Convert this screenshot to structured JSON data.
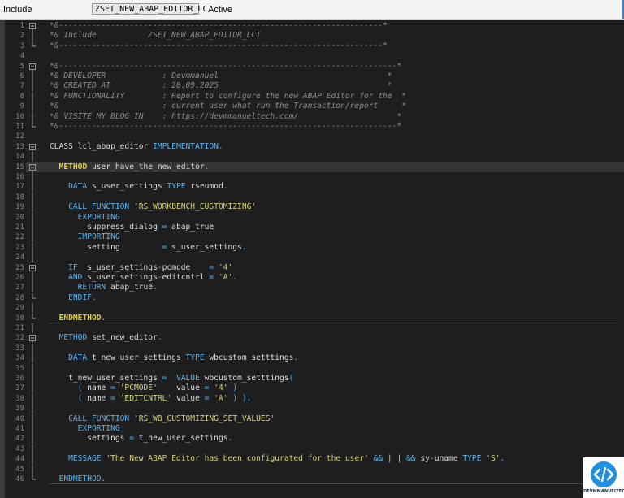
{
  "header": {
    "field_label": "Include",
    "object_name": "ZSET_NEW_ABAP_EDITOR_LCI",
    "status": "Active"
  },
  "editor": {
    "current_line": 15,
    "lines": [
      {
        "n": 1,
        "fold": "open",
        "segs": [
          [
            "c",
            "*&---------------------------------------------------------------------*"
          ]
        ]
      },
      {
        "n": 2,
        "fold": "bar",
        "segs": [
          [
            "c",
            "*& Include           ZSET_NEW_ABAP_EDITOR_LCI"
          ]
        ]
      },
      {
        "n": 3,
        "fold": "end",
        "segs": [
          [
            "c",
            "*&---------------------------------------------------------------------*"
          ]
        ]
      },
      {
        "n": 4,
        "fold": "",
        "segs": []
      },
      {
        "n": 5,
        "fold": "open",
        "segs": [
          [
            "c",
            "*&------------------------------------------------------------------------*"
          ]
        ]
      },
      {
        "n": 6,
        "fold": "bar",
        "segs": [
          [
            "c",
            "*& DEVELOPER            : Devmmanuel                                    *"
          ]
        ]
      },
      {
        "n": 7,
        "fold": "bar",
        "segs": [
          [
            "c",
            "*& CREATED AT           : 20.09.2025                                    *"
          ]
        ]
      },
      {
        "n": 8,
        "fold": "bar",
        "segs": [
          [
            "c",
            "*& FUNCTIONALITY        : Report to configure the new ABAP Editor for the  *"
          ]
        ]
      },
      {
        "n": 9,
        "fold": "bar",
        "segs": [
          [
            "c",
            "*&                      : current user what run the Transaction/report     *"
          ]
        ]
      },
      {
        "n": 10,
        "fold": "bar",
        "segs": [
          [
            "c",
            "*& VISITE MY BLOG IN    : https://devmmanueltech.com/                     *"
          ]
        ]
      },
      {
        "n": 11,
        "fold": "end",
        "segs": [
          [
            "c",
            "*&------------------------------------------------------------------------*"
          ]
        ]
      },
      {
        "n": 12,
        "fold": "",
        "segs": []
      },
      {
        "n": 13,
        "fold": "open",
        "segs": [
          [
            "i",
            "CLASS lcl_abap_editor "
          ],
          [
            "k",
            "IMPLEMENTATION"
          ],
          [
            "o",
            "."
          ]
        ]
      },
      {
        "n": 14,
        "fold": "bar",
        "segs": []
      },
      {
        "n": 15,
        "fold": "open",
        "segs": [
          [
            "i",
            "  "
          ],
          [
            "ky",
            "METHOD"
          ],
          [
            "i",
            " user_have_the_new_editor"
          ],
          [
            "o",
            "."
          ]
        ]
      },
      {
        "n": 16,
        "fold": "bar",
        "segs": []
      },
      {
        "n": 17,
        "fold": "bar",
        "segs": [
          [
            "i",
            "    "
          ],
          [
            "k",
            "DATA"
          ],
          [
            "i",
            " s_user_settings "
          ],
          [
            "k",
            "TYPE"
          ],
          [
            "i",
            " rseumod"
          ],
          [
            "o",
            "."
          ]
        ]
      },
      {
        "n": 18,
        "fold": "bar",
        "segs": []
      },
      {
        "n": 19,
        "fold": "bar",
        "segs": [
          [
            "i",
            "    "
          ],
          [
            "k",
            "CALL FUNCTION"
          ],
          [
            "i",
            " "
          ],
          [
            "s",
            "'RS_WORKBENCH_CUSTOMIZING'"
          ]
        ]
      },
      {
        "n": 20,
        "fold": "bar",
        "segs": [
          [
            "i",
            "      "
          ],
          [
            "k",
            "EXPORTING"
          ]
        ]
      },
      {
        "n": 21,
        "fold": "bar",
        "segs": [
          [
            "i",
            "        suppress_dialog "
          ],
          [
            "o",
            "="
          ],
          [
            "i",
            " abap_true"
          ]
        ]
      },
      {
        "n": 22,
        "fold": "bar",
        "segs": [
          [
            "i",
            "      "
          ],
          [
            "k",
            "IMPORTING"
          ]
        ]
      },
      {
        "n": 23,
        "fold": "bar",
        "segs": [
          [
            "i",
            "        setting         "
          ],
          [
            "o",
            "="
          ],
          [
            "i",
            " s_user_settings"
          ],
          [
            "o",
            "."
          ]
        ]
      },
      {
        "n": 24,
        "fold": "bar",
        "segs": []
      },
      {
        "n": 25,
        "fold": "open",
        "segs": [
          [
            "i",
            "    "
          ],
          [
            "k",
            "IF"
          ],
          [
            "i",
            "  s_user_settings"
          ],
          [
            "o",
            "-"
          ],
          [
            "i",
            "pcmode    "
          ],
          [
            "o",
            "="
          ],
          [
            "i",
            " "
          ],
          [
            "s",
            "'4'"
          ]
        ]
      },
      {
        "n": 26,
        "fold": "bar",
        "segs": [
          [
            "i",
            "    "
          ],
          [
            "k",
            "AND"
          ],
          [
            "i",
            " s_user_settings"
          ],
          [
            "o",
            "-"
          ],
          [
            "i",
            "editcntrl "
          ],
          [
            "o",
            "="
          ],
          [
            "i",
            " "
          ],
          [
            "s",
            "'A'"
          ],
          [
            "o",
            "."
          ]
        ]
      },
      {
        "n": 27,
        "fold": "bar",
        "segs": [
          [
            "i",
            "      "
          ],
          [
            "k",
            "RETURN"
          ],
          [
            "i",
            " abap_true"
          ],
          [
            "o",
            "."
          ]
        ]
      },
      {
        "n": 28,
        "fold": "end",
        "segs": [
          [
            "i",
            "    "
          ],
          [
            "k",
            "ENDIF"
          ],
          [
            "o",
            "."
          ]
        ]
      },
      {
        "n": 29,
        "fold": "bar",
        "segs": []
      },
      {
        "n": 30,
        "fold": "end",
        "segs": [
          [
            "i",
            "  "
          ],
          [
            "ky",
            "ENDMETHOD"
          ],
          [
            "o",
            "."
          ]
        ]
      },
      {
        "n": 31,
        "fold": "bar",
        "segs": []
      },
      {
        "n": 32,
        "fold": "open",
        "segs": [
          [
            "i",
            "  "
          ],
          [
            "k",
            "METHOD"
          ],
          [
            "i",
            " set_new_editor"
          ],
          [
            "o",
            "."
          ]
        ]
      },
      {
        "n": 33,
        "fold": "bar",
        "segs": []
      },
      {
        "n": 34,
        "fold": "bar",
        "segs": [
          [
            "i",
            "    "
          ],
          [
            "k",
            "DATA"
          ],
          [
            "i",
            " t_new_user_settings "
          ],
          [
            "k",
            "TYPE"
          ],
          [
            "i",
            " wbcustom_setttings"
          ],
          [
            "o",
            "."
          ]
        ]
      },
      {
        "n": 35,
        "fold": "bar",
        "segs": []
      },
      {
        "n": 36,
        "fold": "bar",
        "segs": [
          [
            "i",
            "    t_new_user_settings "
          ],
          [
            "o",
            "="
          ],
          [
            "i",
            "  "
          ],
          [
            "k",
            "VALUE"
          ],
          [
            "i",
            " wbcustom_setttings"
          ],
          [
            "o",
            "("
          ]
        ]
      },
      {
        "n": 37,
        "fold": "bar",
        "segs": [
          [
            "i",
            "      "
          ],
          [
            "o",
            "("
          ],
          [
            "i",
            " name "
          ],
          [
            "o",
            "="
          ],
          [
            "i",
            " "
          ],
          [
            "s",
            "'PCMODE'"
          ],
          [
            "i",
            "    value "
          ],
          [
            "o",
            "="
          ],
          [
            "i",
            " "
          ],
          [
            "s",
            "'4'"
          ],
          [
            "i",
            " "
          ],
          [
            "o",
            ")"
          ]
        ]
      },
      {
        "n": 38,
        "fold": "bar",
        "segs": [
          [
            "i",
            "      "
          ],
          [
            "o",
            "("
          ],
          [
            "i",
            " name "
          ],
          [
            "o",
            "="
          ],
          [
            "i",
            " "
          ],
          [
            "s",
            "'EDITCNTRL'"
          ],
          [
            "i",
            " value "
          ],
          [
            "o",
            "="
          ],
          [
            "i",
            " "
          ],
          [
            "s",
            "'A'"
          ],
          [
            "i",
            " "
          ],
          [
            "o",
            ")"
          ],
          [
            "i",
            " "
          ],
          [
            "o",
            ")."
          ]
        ]
      },
      {
        "n": 39,
        "fold": "bar",
        "segs": []
      },
      {
        "n": 40,
        "fold": "bar",
        "segs": [
          [
            "i",
            "    "
          ],
          [
            "k",
            "CALL FUNCTION"
          ],
          [
            "i",
            " "
          ],
          [
            "s",
            "'RS_WB_CUSTOMIZING_SET_VALUES'"
          ]
        ]
      },
      {
        "n": 41,
        "fold": "bar",
        "segs": [
          [
            "i",
            "      "
          ],
          [
            "k",
            "EXPORTING"
          ]
        ]
      },
      {
        "n": 42,
        "fold": "bar",
        "segs": [
          [
            "i",
            "        settings "
          ],
          [
            "o",
            "="
          ],
          [
            "i",
            " t_new_user_settings"
          ],
          [
            "o",
            "."
          ]
        ]
      },
      {
        "n": 43,
        "fold": "bar",
        "segs": []
      },
      {
        "n": 44,
        "fold": "bar",
        "segs": [
          [
            "i",
            "    "
          ],
          [
            "k",
            "MESSAGE"
          ],
          [
            "i",
            " "
          ],
          [
            "s",
            "'The New ABAP Editor has been configurated for the user'"
          ],
          [
            "i",
            " "
          ],
          [
            "o",
            "&&"
          ],
          [
            "i",
            " "
          ],
          [
            "s",
            "|"
          ],
          [
            "i",
            " "
          ],
          [
            "s",
            "|"
          ],
          [
            "i",
            " "
          ],
          [
            "o",
            "&&"
          ],
          [
            "i",
            " sy"
          ],
          [
            "o",
            "-"
          ],
          [
            "i",
            "uname "
          ],
          [
            "k",
            "TYPE"
          ],
          [
            "i",
            " "
          ],
          [
            "s",
            "'S'"
          ],
          [
            "o",
            "."
          ]
        ]
      },
      {
        "n": 45,
        "fold": "bar",
        "segs": []
      },
      {
        "n": 46,
        "fold": "end",
        "segs": [
          [
            "i",
            "  "
          ],
          [
            "k",
            "ENDMETHOD"
          ],
          [
            "o",
            "."
          ]
        ]
      }
    ]
  },
  "watermark": {
    "text": "DEVMMANUELTECH",
    "colors": {
      "blue": "#1f8fe0",
      "navy": "#1a2b44"
    }
  }
}
